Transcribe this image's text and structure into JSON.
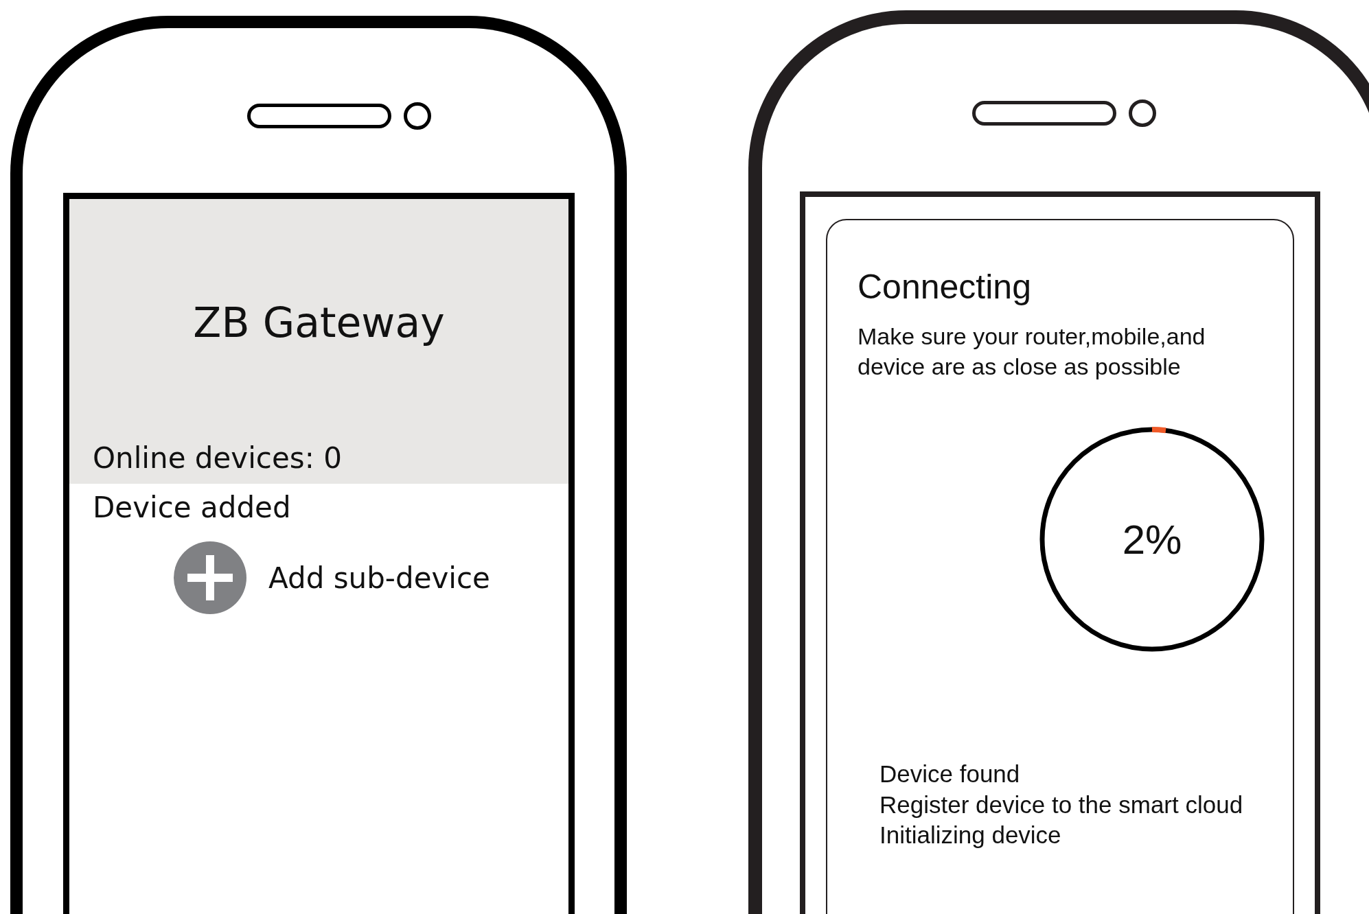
{
  "phones": [
    {
      "kind": "gateway",
      "title": "ZB Gateway",
      "online_devices": "Online devices: 0",
      "section": "Device added",
      "add_button": "Add sub-device"
    },
    {
      "kind": "connecting",
      "title": "Connecting",
      "message": "Make sure your router,mobile,and device are as close as possible",
      "progress": {
        "level": 0.02,
        "reading": "2%"
      },
      "steps": [
        "Device found",
        "Register device to the smart cloud",
        "Initializing device"
      ]
    }
  ]
}
